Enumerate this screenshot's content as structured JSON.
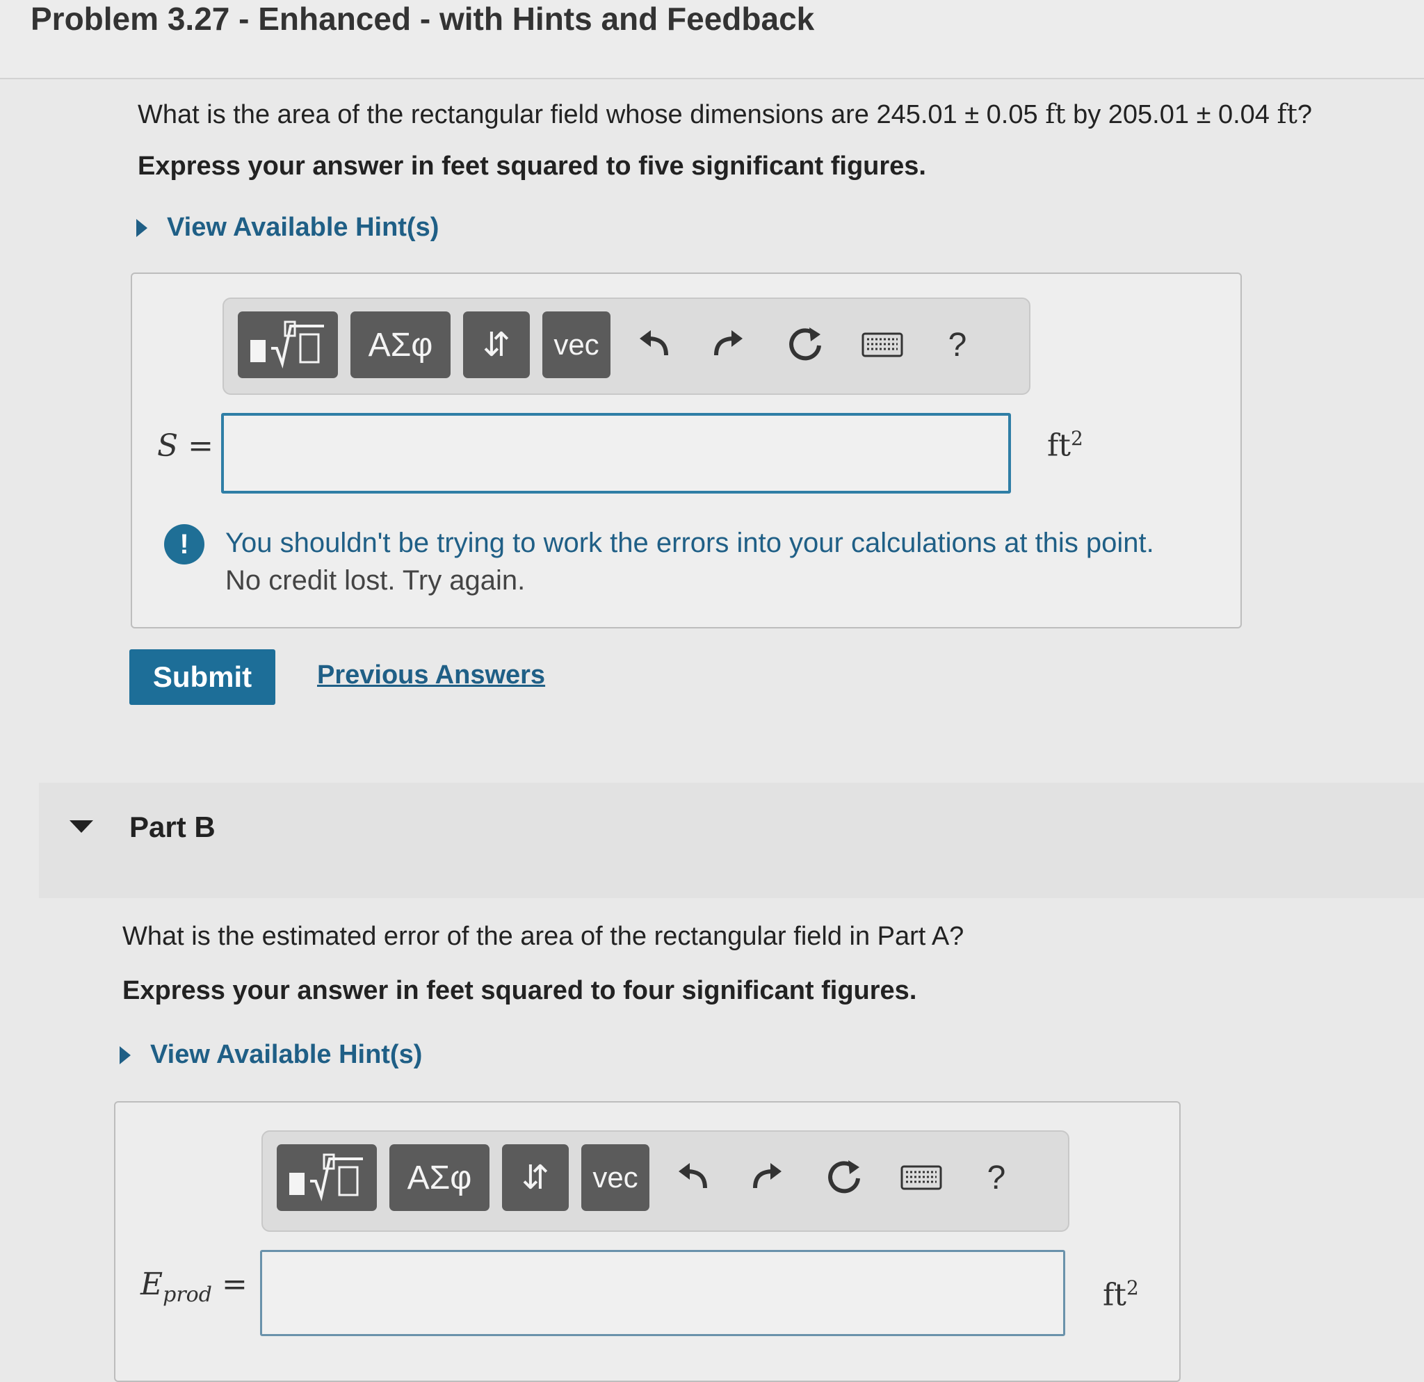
{
  "header": {
    "title": "Problem 3.27 - Enhanced - with Hints and Feedback"
  },
  "partA": {
    "question_prefix": "What is the area of the rectangular field whose dimensions are 245.01 ± 0.05 ",
    "unit1": "ft",
    "question_mid": " by 205.01 ± 0.04 ",
    "unit2": "ft",
    "question_suffix": "?",
    "instruction": "Express your answer in feet squared to five significant figures.",
    "hint_label": "View Available Hint(s)",
    "toolbar": {
      "template_btn": "template-radical",
      "greek_btn": "ΑΣφ",
      "arrows_btn": "⇵",
      "vec_btn": "vec",
      "help": "?"
    },
    "variable": "S",
    "equals": "=",
    "answer_value": "",
    "unit_base": "ft",
    "unit_exp": "2",
    "feedback_icon": "!",
    "feedback_line1": "You shouldn't be trying to work the errors into your calculations at this point.",
    "feedback_line2": "No credit lost. Try again.",
    "submit_label": "Submit",
    "previous_answers_label": "Previous Answers"
  },
  "partB": {
    "title": "Part B",
    "question": "What is the estimated error of the area of the rectangular field in Part A?",
    "instruction": "Express your answer in feet squared to four significant figures.",
    "hint_label": "View Available Hint(s)",
    "toolbar": {
      "greek_btn": "ΑΣφ",
      "arrows_btn": "⇵",
      "vec_btn": "vec",
      "help": "?"
    },
    "variable": "E",
    "variable_sub": "prod",
    "equals": "=",
    "answer_value": "",
    "unit_base": "ft",
    "unit_exp": "2"
  },
  "colors": {
    "accent": "#1d6e98",
    "link": "#1f5f86",
    "toolbar_button": "#5b5b5b"
  }
}
